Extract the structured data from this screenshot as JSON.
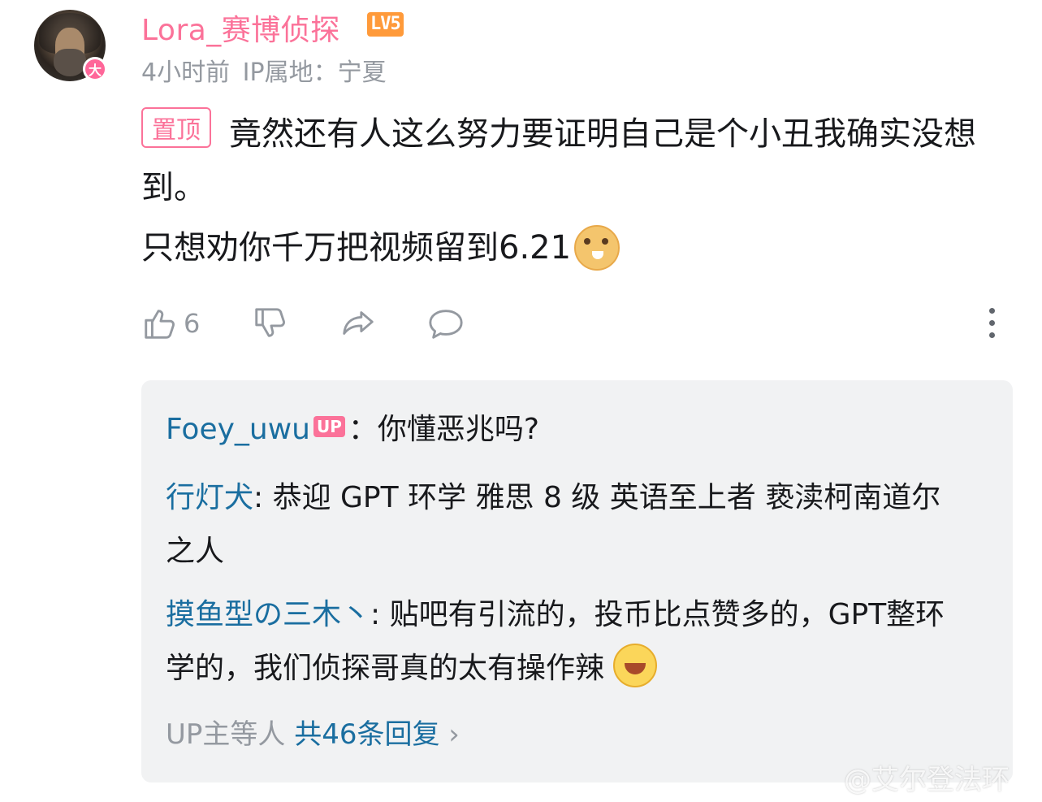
{
  "comment": {
    "username": "Lora_赛博侦探",
    "level": "LV5",
    "avatar_badge": "大",
    "time": "4小时前",
    "ip_location": "IP属地：宁夏",
    "pin_label": "置顶",
    "text_line1": "竟然还有人这么努力要证明自己是个小丑我确实没想到。",
    "text_line2": "只想劝你千万把视频留到6.21",
    "like_count": "6"
  },
  "replies": [
    {
      "name": "Foey_uwu",
      "tag": "UP",
      "text": "：你懂恶兆吗?"
    },
    {
      "name": "行灯犬",
      "text": ": 恭迎 GPT 环学 雅思 8 级 英语至上者 亵渎柯南道尔之人"
    },
    {
      "name": "摸鱼型の三木丶",
      "text": ": 贴吧有引流的，投币比点赞多的，GPT整环学的，我们侦探哥真的太有操作辣"
    }
  ],
  "more_replies": {
    "prefix": "UP主等人",
    "count_text": "共46条回复",
    "chevron": "›"
  },
  "watermark": "@艾尔登法环"
}
